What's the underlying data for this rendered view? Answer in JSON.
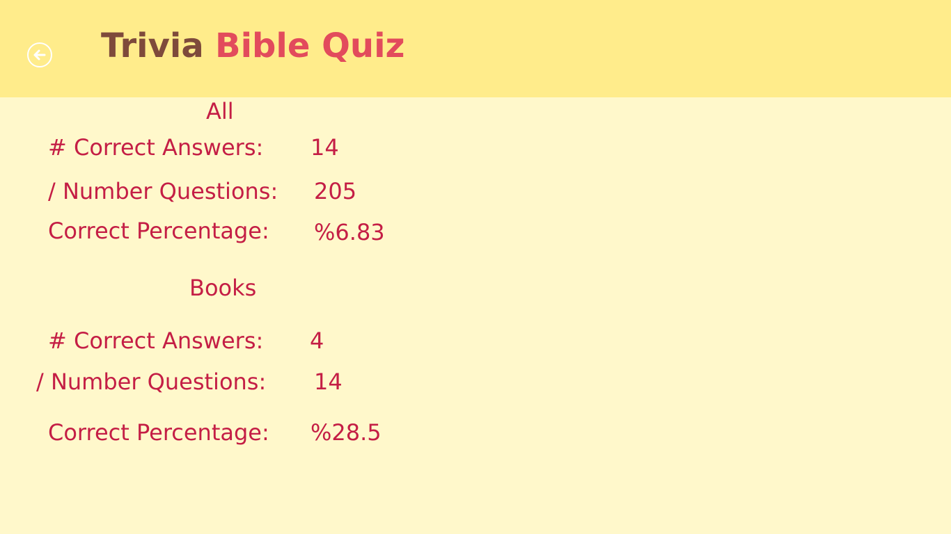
{
  "header": {
    "back_icon": "arrow-left-circle-icon",
    "title_part1": "Trivia",
    "title_part2": "Bible Quiz",
    "colors": {
      "header_bg": "#FFEC8B",
      "page_bg": "#FFF8CB",
      "title_part1": "#7E4A3B",
      "title_part2": "#E24B5C",
      "text": "#C41E45"
    }
  },
  "sections": [
    {
      "heading": "All",
      "correct_label": "# Correct Answers:",
      "correct_value": "14",
      "questions_label": "/ Number Questions:",
      "questions_value": "205",
      "percent_label": "Correct Percentage:",
      "percent_value": "%6.83"
    },
    {
      "heading": "Books",
      "correct_label": "# Correct Answers:",
      "correct_value": "4",
      "questions_label": "/ Number Questions:",
      "questions_value": "14",
      "percent_label": "Correct Percentage:",
      "percent_value": "%28.5"
    }
  ]
}
